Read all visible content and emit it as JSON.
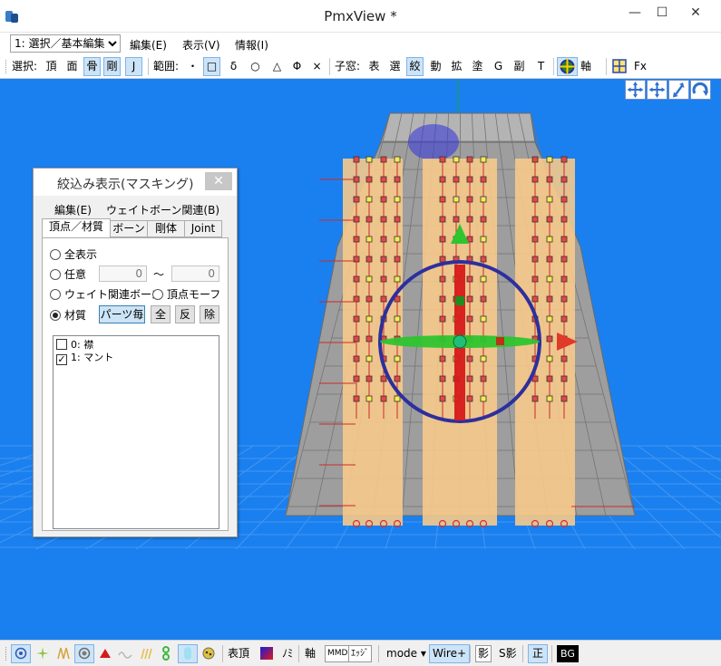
{
  "window": {
    "title": "PmxView *",
    "minimize_glyph": "—",
    "maximize_glyph": "☐",
    "close_glyph": "✕"
  },
  "menubar": {
    "mode_select": "1: 選択／基本編集",
    "items": [
      "編集(E)",
      "表示(V)",
      "情報(I)"
    ]
  },
  "toolbar": {
    "select_label": "選択:",
    "select_buttons": [
      "頂",
      "面",
      "骨",
      "剛",
      "J"
    ],
    "range_label": "範囲:",
    "range_buttons": [
      "・",
      "□",
      "δ",
      "○",
      "△",
      "Φ",
      "×"
    ],
    "child_window_label": "子窓:",
    "child_buttons": [
      "表",
      "選",
      "絞",
      "動",
      "拡",
      "塗",
      "G",
      "副",
      "T"
    ],
    "axis_label": "軸",
    "fx_label": "Fx"
  },
  "mask_dialog": {
    "title": "絞込み表示(マスキング)",
    "close_glyph": "✕",
    "menu": [
      "編集(E)",
      "ウェイトボーン関連(B)"
    ],
    "tabs": [
      "頂点／材質",
      "ボーン",
      "剛体",
      "Joint"
    ],
    "options": {
      "show_all": "全表示",
      "arbitrary": "任意",
      "range_from": "0",
      "range_tilde": "〜",
      "range_to": "0",
      "weight_bone": "ウェイト関連ボーン",
      "vertex_morph": "頂点モーフ",
      "material": "材質",
      "per_part": "パーツ毎",
      "all": "全",
      "invert": "反",
      "exclude": "除"
    },
    "materials": [
      {
        "label": "0: 襟",
        "checked": false
      },
      {
        "label": "1: マント",
        "checked": true
      }
    ]
  },
  "bottom_toolbar": {
    "vertex_label": "表頂",
    "no_label": "ﾉﾐ",
    "axis_label": "軸",
    "mmd_label": "MMD",
    "edge_label": "ｴｯｼﾞ",
    "mode_label": "mode ▾",
    "wire_label": "Wire+",
    "shadow_label": "影",
    "sshadow_label": "S影",
    "ortho_label": "正",
    "bg_label": "BG"
  },
  "colors": {
    "viewport_bg": "#1a80ef",
    "selected_button": "#cde4f7",
    "gizmo_ring": "#2d2f9e",
    "gizmo_x": "#2ec52e",
    "gizmo_y": "#d61a1a",
    "strip_fill": "#f6c98a"
  }
}
